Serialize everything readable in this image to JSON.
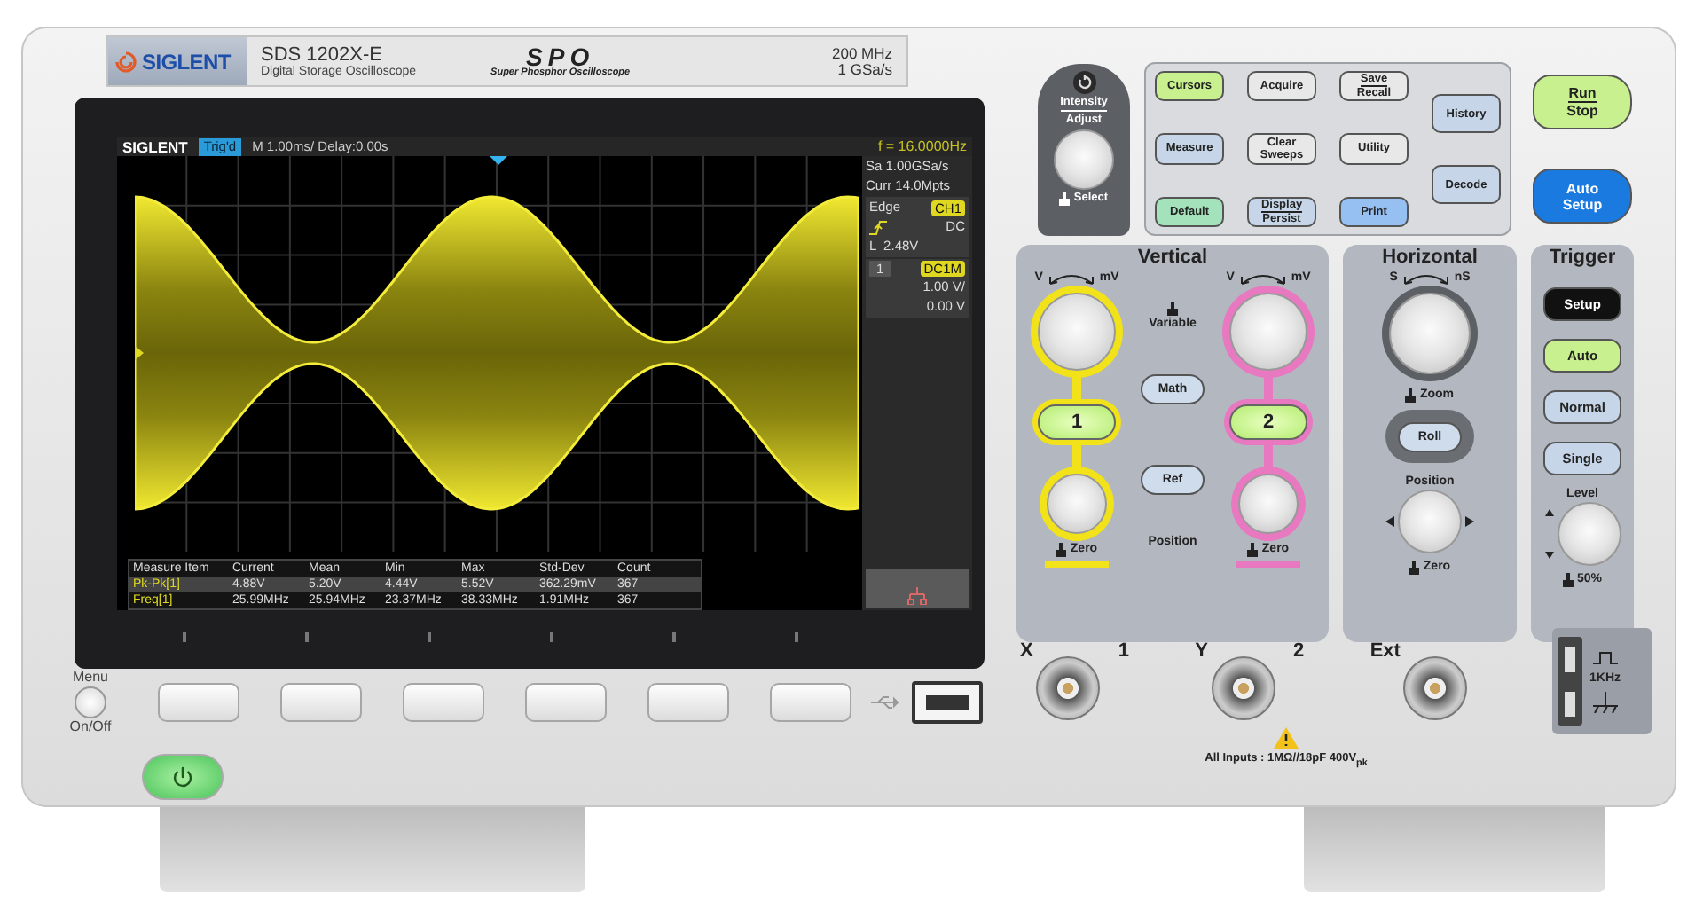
{
  "header": {
    "brand": "SIGLENT",
    "model": "SDS 1202X-E",
    "subtitle": "Digital Storage Oscilloscope",
    "spo_logo": "SPO",
    "spo_caption": "Super Phosphor Oscilloscope",
    "bandwidth": "200 MHz",
    "sample_rate": "1 GSa/s"
  },
  "screen": {
    "brand": "SIGLENT",
    "trigger_status": "Trig'd",
    "timebase": "M 1.00ms/ Delay:0.00s",
    "frequency": "f = 16.0000Hz",
    "info": {
      "sample_rate": "Sa 1.00GSa/s",
      "memory": "Curr 14.0Mpts",
      "trigger_type": "Edge",
      "trigger_source": "CH1",
      "trigger_coupling": "DC",
      "trigger_level": "L  2.48V",
      "channel": "1",
      "channel_coupling": "DC1M",
      "volts_per_div": "1.00 V/",
      "offset": "0.00 V"
    },
    "measurements": {
      "columns": [
        "Measure Item",
        "Current",
        "Mean",
        "Min",
        "Max",
        "Std-Dev",
        "Count"
      ],
      "rows": [
        {
          "selected": true,
          "cells": [
            "Pk-Pk[1]",
            "4.88V",
            "5.20V",
            "4.44V",
            "5.52V",
            "362.29mV",
            "367"
          ]
        },
        {
          "selected": false,
          "cells": [
            "Freq[1]",
            "25.99MHz",
            "25.94MHz",
            "23.37MHz",
            "38.33MHz",
            "1.91MHz",
            "367"
          ]
        }
      ]
    }
  },
  "softkeys": {
    "menu_label": "Menu",
    "power_label": "On/Off"
  },
  "intensity": {
    "label_top": "Intensity",
    "label_bottom": "Adjust",
    "push_label": "Select"
  },
  "function_buttons": [
    [
      {
        "lines": [
          "Cursors"
        ],
        "kind": "single",
        "color": "#c8f08e"
      },
      {
        "lines": [
          "Measure"
        ],
        "kind": "single",
        "color": "#c6d6e8"
      },
      {
        "lines": [
          "Default"
        ],
        "kind": "single",
        "color": "#a4e2bc"
      }
    ],
    [
      {
        "lines": [
          "Acquire"
        ],
        "kind": "single",
        "color": "#e8e8e8"
      },
      {
        "lines": [
          "Clear",
          "Sweeps"
        ],
        "kind": "stacked",
        "color": "#e8e8e8"
      },
      {
        "lines": [
          "Display",
          "Persist"
        ],
        "kind": "split",
        "color": "#c6d6e8"
      }
    ],
    [
      {
        "lines": [
          "Save",
          "Recall"
        ],
        "kind": "split",
        "color": "#e8e8e8"
      },
      {
        "lines": [
          "Utility"
        ],
        "kind": "single",
        "color": "#e8e8e8"
      },
      {
        "lines": [
          "Print"
        ],
        "kind": "single",
        "color": "#96c0f2"
      }
    ],
    [
      {
        "lines": [
          "History"
        ],
        "kind": "single",
        "color": "#c6d6e8"
      },
      {
        "lines": [
          "Decode"
        ],
        "kind": "single",
        "color": "#c6d6e8"
      }
    ]
  ],
  "run_controls": [
    {
      "lines": [
        "Run",
        "Stop"
      ],
      "kind": "split",
      "color": "#c8f08e"
    },
    {
      "lines": [
        "Auto",
        "Setup"
      ],
      "kind": "stacked",
      "color": "#1b7ae0"
    }
  ],
  "vertical": {
    "title": "Vertical",
    "variable_label": "Variable",
    "math": "Math",
    "ref": "Ref",
    "position_label": "Position",
    "channels": [
      {
        "number": "1",
        "color": "#f2e21a",
        "scale_left": "V",
        "scale_right": "mV",
        "zero_label": "Zero"
      },
      {
        "number": "2",
        "color": "#e878c0",
        "scale_left": "V",
        "scale_right": "mV",
        "zero_label": "Zero"
      }
    ]
  },
  "horizontal": {
    "title": "Horizontal",
    "scale_left": "S",
    "scale_right": "nS",
    "zoom_label": "Zoom",
    "roll": "Roll",
    "position_label": "Position",
    "zero_label": "Zero"
  },
  "trigger": {
    "title": "Trigger",
    "buttons": [
      {
        "label": "Setup",
        "color": "#111111"
      },
      {
        "label": "Auto",
        "color": "#c8f08e"
      },
      {
        "label": "Normal",
        "color": "#c6d6e8"
      },
      {
        "label": "Single",
        "color": "#c6d6e8"
      }
    ],
    "level_label": "Level",
    "push_label": "50%"
  },
  "inputs": [
    {
      "label": "X",
      "number": "1"
    },
    {
      "label": "Y",
      "number": "2"
    },
    {
      "label": "Ext"
    }
  ],
  "input_rating": "All Inputs : 1MΩ//18pF  400V$_{pk}$",
  "probe_compensation": {
    "frequency": "1KHz"
  }
}
